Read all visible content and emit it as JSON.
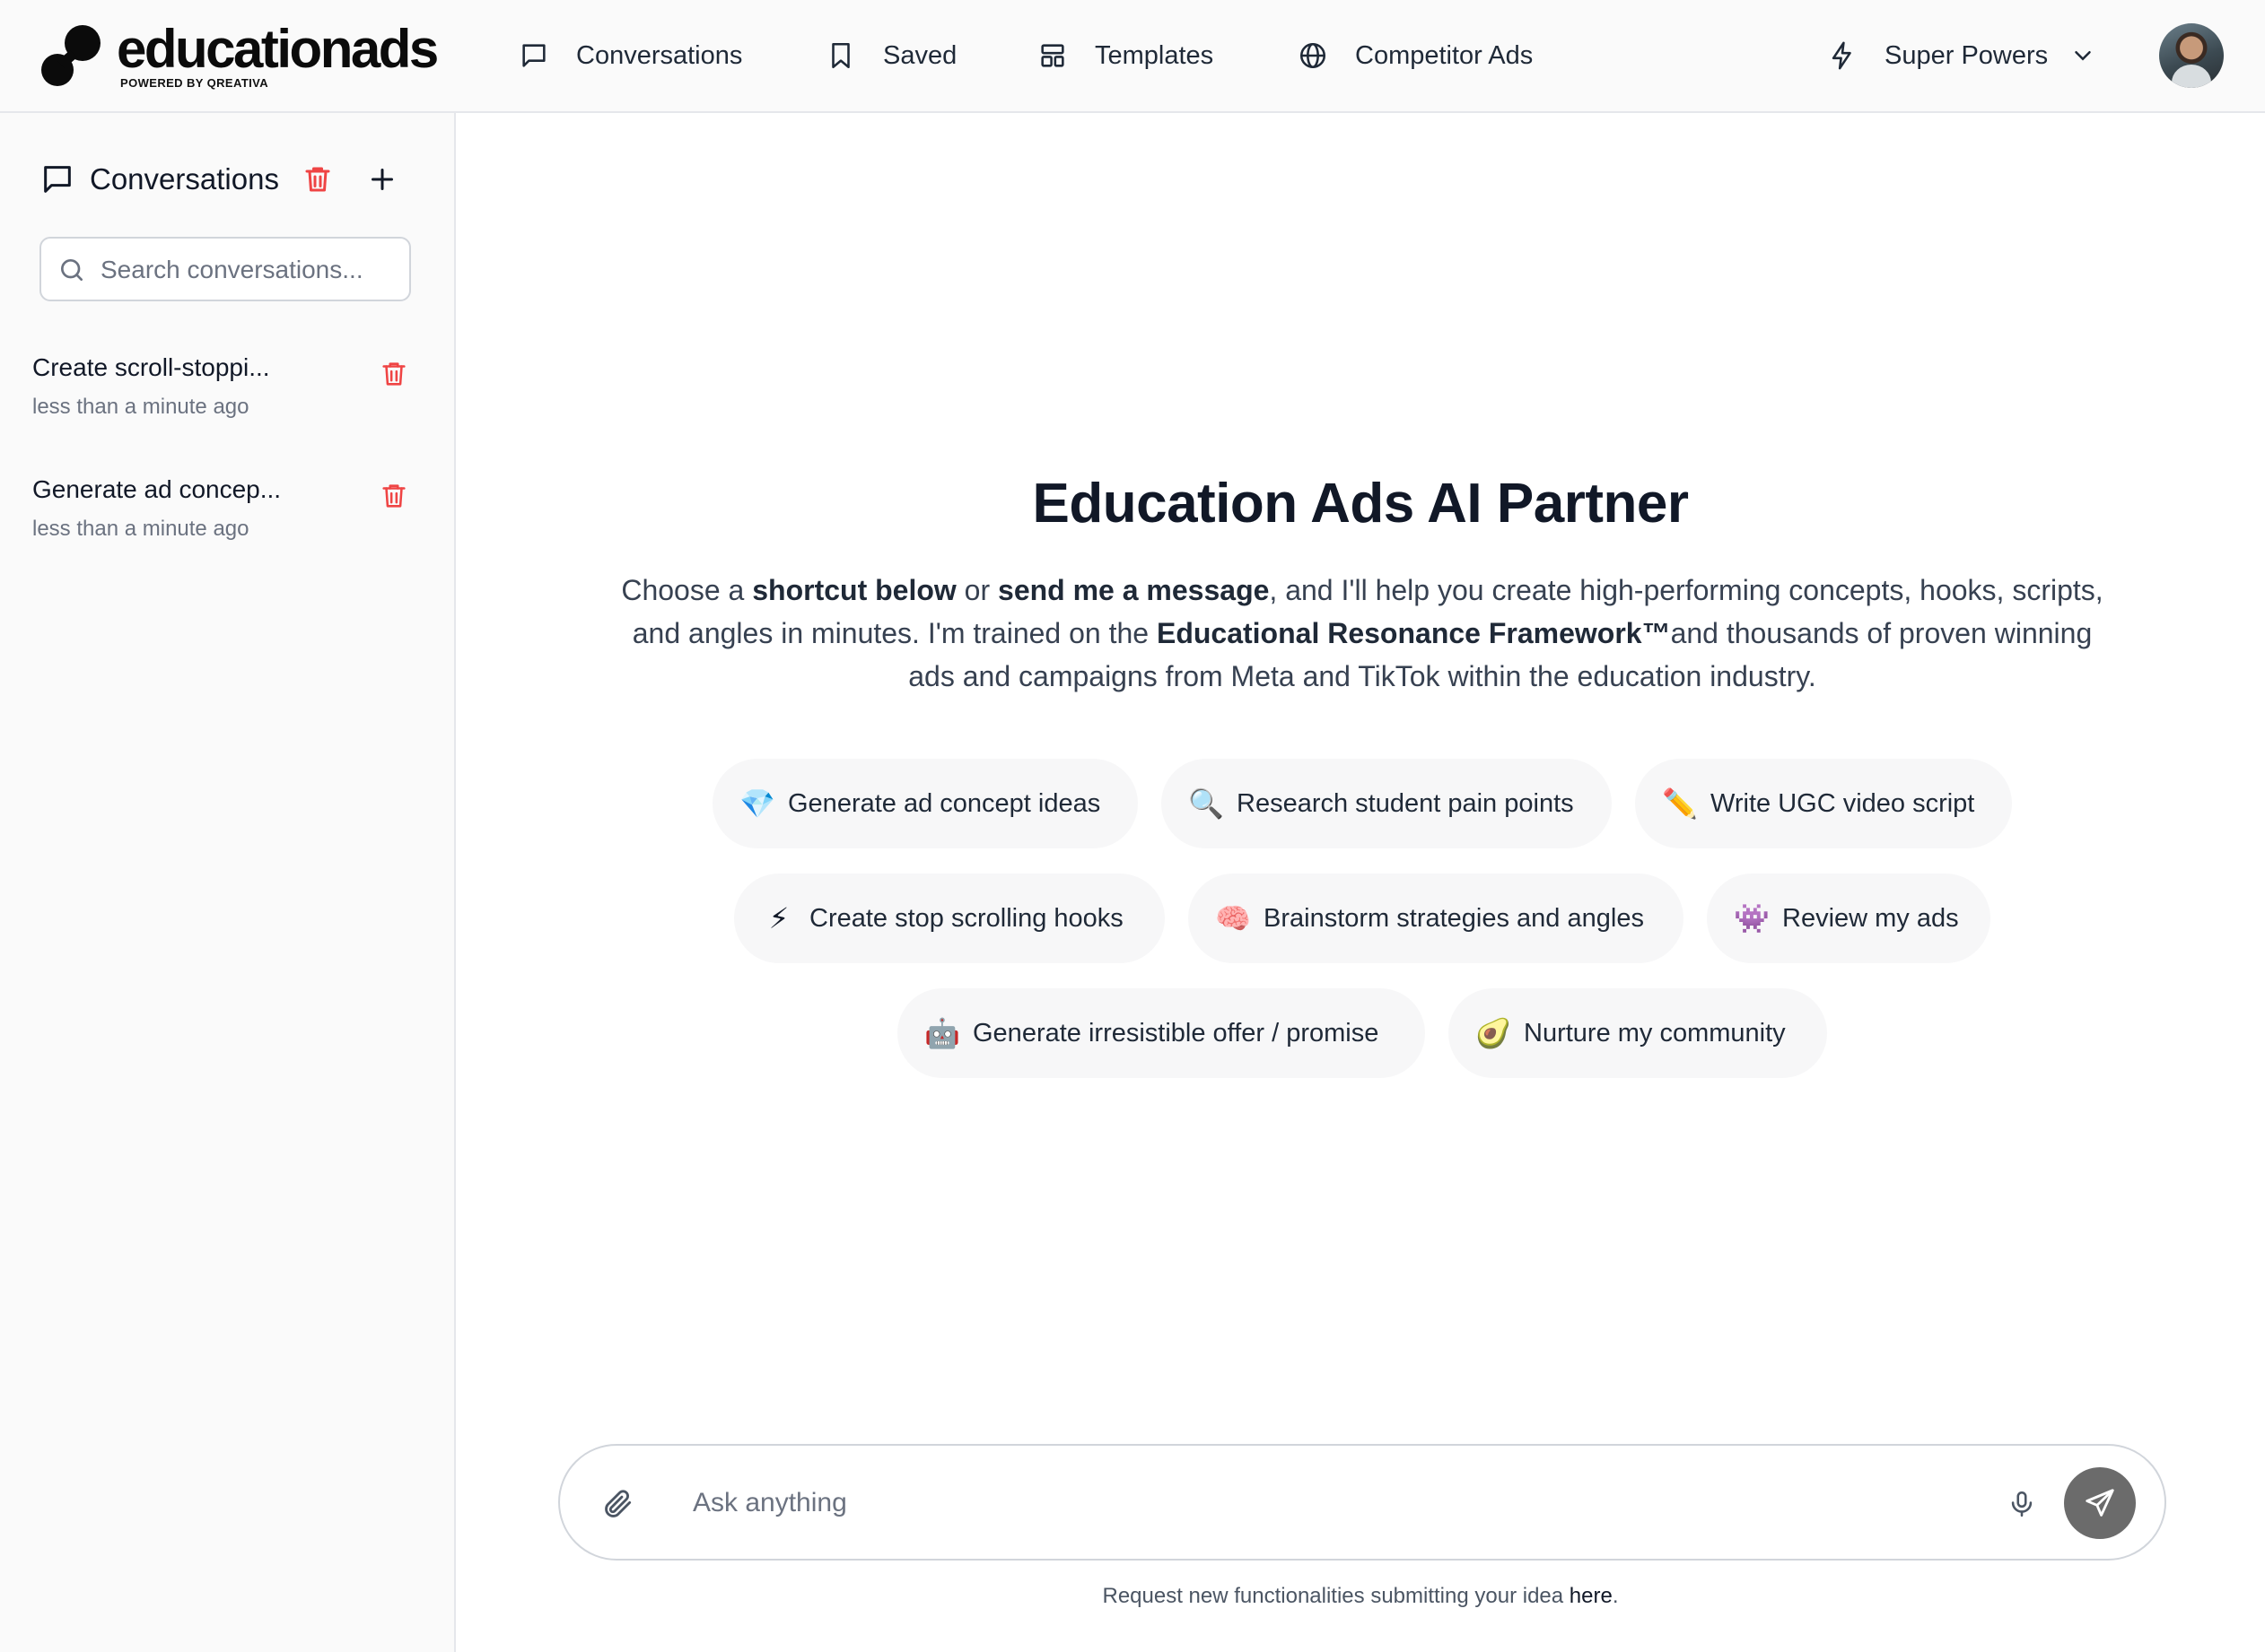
{
  "brand": {
    "name": "educationads",
    "tagline": "POWERED BY QREATIVA"
  },
  "nav": {
    "items": [
      {
        "label": "Conversations",
        "icon": "chat-bubble-icon"
      },
      {
        "label": "Saved",
        "icon": "bookmark-icon"
      },
      {
        "label": "Templates",
        "icon": "layout-template-icon"
      },
      {
        "label": "Competitor Ads",
        "icon": "globe-icon"
      }
    ],
    "super_powers": {
      "label": "Super Powers",
      "icon": "lightning-icon"
    }
  },
  "sidebar": {
    "title": "Conversations",
    "search_placeholder": "Search conversations...",
    "conversations": [
      {
        "title": "Create scroll-stoppi...",
        "time": "less than a minute ago"
      },
      {
        "title": "Generate ad concep...",
        "time": "less than a minute ago"
      }
    ]
  },
  "hero": {
    "title": "Education Ads AI Partner",
    "desc": {
      "p1": "Choose a ",
      "b1": "shortcut below",
      "p2": " or ",
      "b2": "send me a message",
      "p3": ", and I'll help you create high-performing concepts, hooks, scripts, and angles in minutes. I'm trained on the ",
      "b3": "Educational Resonance Framework™",
      "p4": "and thousands of proven winning ads and campaigns from Meta and TikTok within the education industry."
    }
  },
  "shortcuts": [
    {
      "emoji": "💎",
      "label": "Generate ad concept ideas"
    },
    {
      "emoji": "🔍",
      "label": "Research student pain points"
    },
    {
      "emoji": "✏️",
      "label": "Write UGC video script"
    },
    {
      "emoji": "⚡",
      "label": "Create stop scrolling hooks"
    },
    {
      "emoji": "🧠",
      "label": "Brainstorm strategies and angles"
    },
    {
      "emoji": "👾",
      "label": "Review my ads"
    },
    {
      "emoji": "🤖",
      "label": "Generate irresistible offer / promise"
    },
    {
      "emoji": "🥑",
      "label": "Nurture my community"
    }
  ],
  "composer": {
    "placeholder": "Ask anything"
  },
  "footer": {
    "text": "Request new functionalities submitting your idea ",
    "link": "here",
    "end": "."
  },
  "colors": {
    "danger": "#ef4444",
    "send_button": "#6b6b6b",
    "chip_bg": "#f7f7f8",
    "sidebar_bg": "#fafafa"
  }
}
